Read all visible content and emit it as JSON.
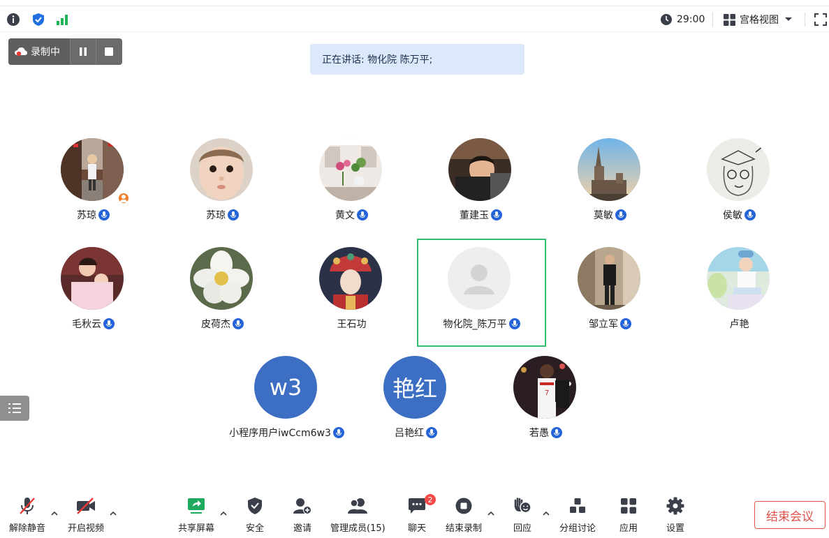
{
  "topbar": {
    "timer": "29:00",
    "view_mode": "宫格视图"
  },
  "recording": {
    "status": "录制中"
  },
  "speaking": {
    "text": "正在讲话: 物化院  陈万平;"
  },
  "participants": [
    {
      "name": "苏琼",
      "avatar": "photo-street"
    },
    {
      "name": "苏琼",
      "avatar": "photo-baby"
    },
    {
      "name": "黄文",
      "avatar": "photo-flowers"
    },
    {
      "name": "董建玉",
      "avatar": "photo-toddler"
    },
    {
      "name": "莫敏",
      "avatar": "photo-church"
    },
    {
      "name": "侯敏",
      "avatar": "photo-sketch"
    },
    {
      "name": "毛秋云",
      "avatar": "photo-mother-child"
    },
    {
      "name": "皮荷杰",
      "avatar": "photo-white-flower"
    },
    {
      "name": "王石功",
      "avatar": "photo-opera"
    },
    {
      "name": "物化院_陈万平",
      "avatar": "default-avatar"
    },
    {
      "name": "邹立军",
      "avatar": "photo-man-standing"
    },
    {
      "name": "卢艳",
      "avatar": "photo-baby-chair"
    },
    {
      "name": "小程序用户iwCcm6w3",
      "avatar": "initials",
      "initials": "w3"
    },
    {
      "name": "吕艳红",
      "avatar": "initials",
      "initials": "艳红"
    },
    {
      "name": "若愚",
      "avatar": "photo-basketball"
    }
  ],
  "toolbar": {
    "mute": "解除静音",
    "video": "开启视频",
    "share": "共享屏幕",
    "security": "安全",
    "invite": "邀请",
    "members": "管理成员(15)",
    "chat": "聊天",
    "chat_badge": "2",
    "end_record": "结束录制",
    "reaction": "回应",
    "breakout": "分组讨论",
    "apps": "应用",
    "settings": "设置",
    "end_meeting": "结束会议"
  },
  "colors": {
    "accent": "#2563d9",
    "active_border": "#2fbf71",
    "danger": "#e0524a",
    "speaking_bg": "#dbe9fb"
  }
}
